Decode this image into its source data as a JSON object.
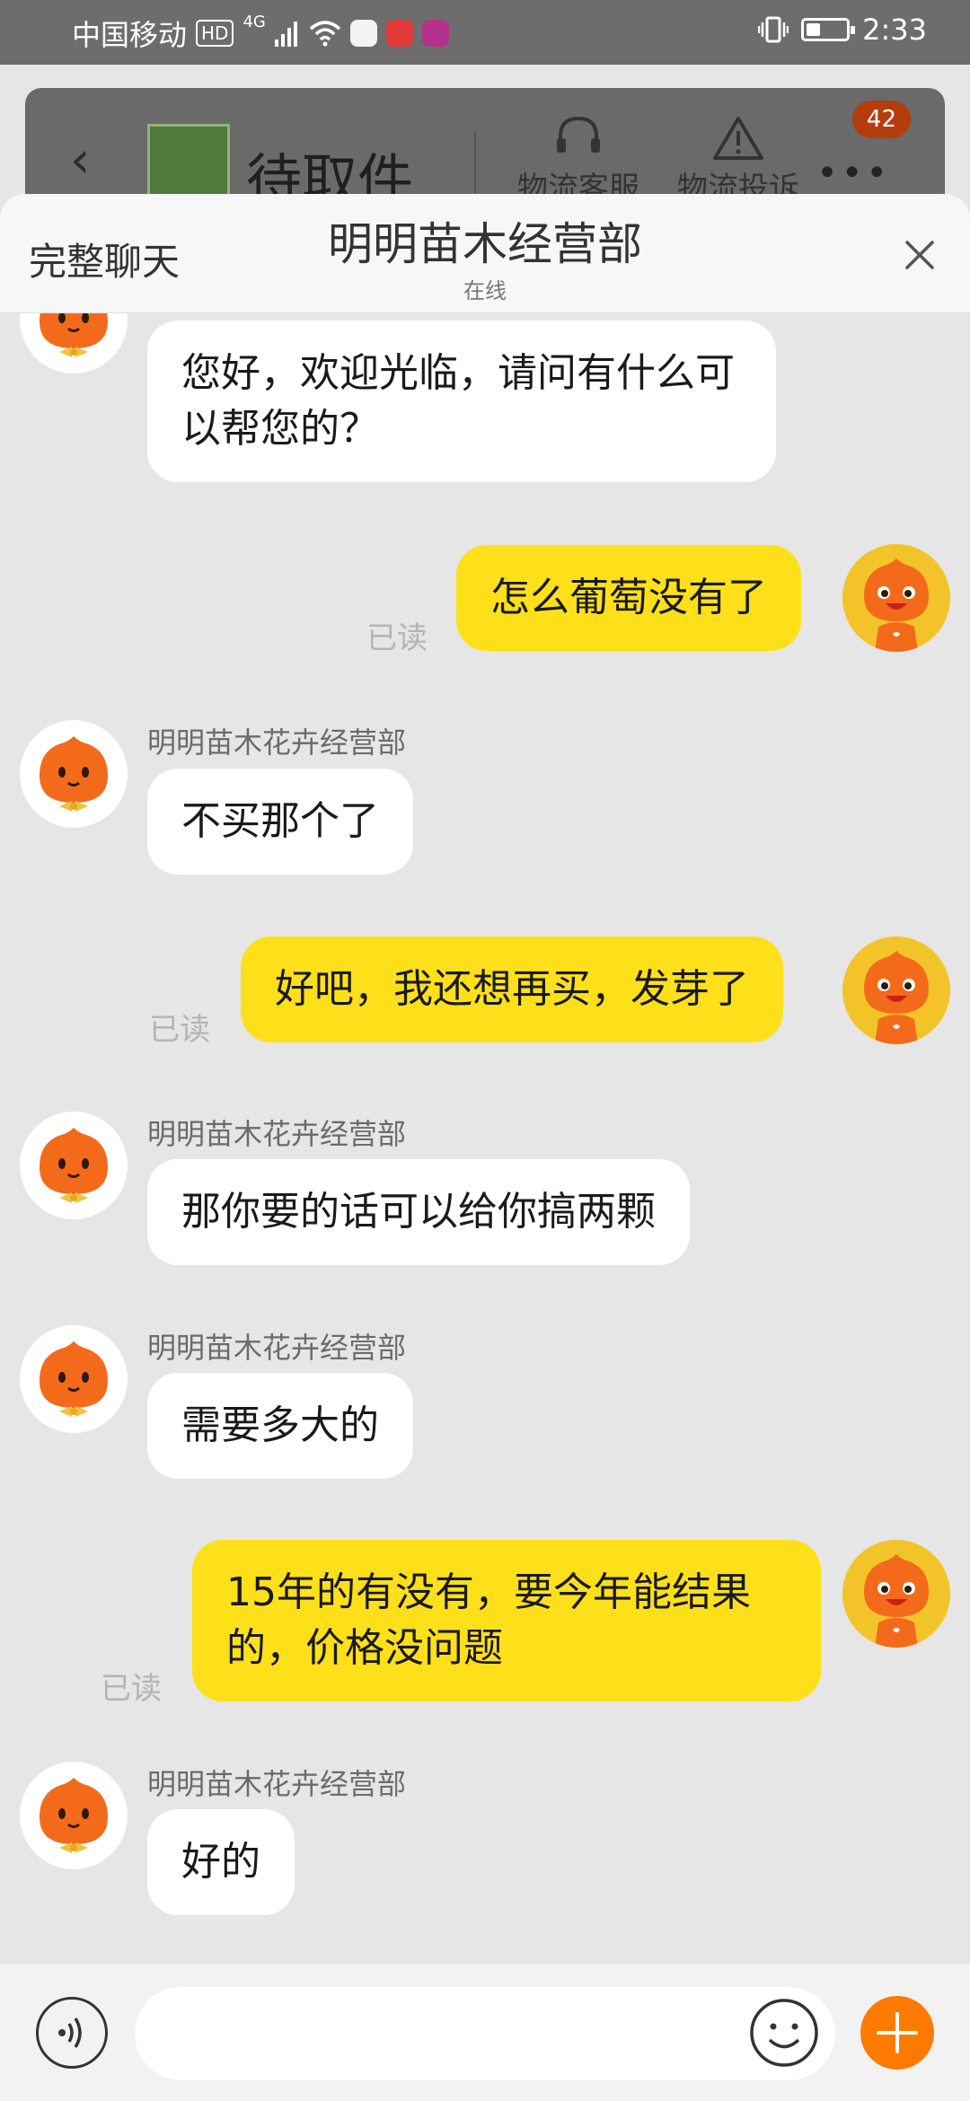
{
  "status_bar": {
    "carrier": "中国移动",
    "hd": "HD",
    "network": "4G",
    "time": "2:33",
    "battery_level": 0.35
  },
  "background_header": {
    "title": "待取件",
    "actions": [
      "物流客服",
      "物流投诉"
    ],
    "badge": "42"
  },
  "chat_header": {
    "full_chat_label": "完整聊天",
    "title": "明明苗木经营部",
    "status": "在线"
  },
  "messages": [
    {
      "side": "in",
      "sender": "",
      "text": "您好，欢迎光临，请问有什么可以帮您的？"
    },
    {
      "side": "out",
      "text": "怎么葡萄没有了",
      "read": "已读"
    },
    {
      "side": "in",
      "sender": "明明苗木花卉经营部",
      "text": "不买那个了"
    },
    {
      "side": "out",
      "text": "好吧，我还想再买，发芽了",
      "read": "已读"
    },
    {
      "side": "in",
      "sender": "明明苗木花卉经营部",
      "text": "那你要的话可以给你搞两颗"
    },
    {
      "side": "in",
      "sender": "明明苗木花卉经营部",
      "text": "需要多大的"
    },
    {
      "side": "out",
      "text": "15年的有没有，要今年能结果的，价格没问题",
      "read": "已读"
    },
    {
      "side": "in",
      "sender": "明明苗木花卉经营部",
      "text": "好的"
    }
  ],
  "input": {
    "placeholder": ""
  },
  "icons": {
    "back": "chevron-left-icon",
    "headset": "headset-icon",
    "warning": "warning-icon",
    "more": "more-dots-icon",
    "close": "close-icon",
    "voice": "voice-icon",
    "emoji": "emoji-icon",
    "plus": "plus-icon"
  },
  "colors": {
    "outgoing_bubble": "#fee01a",
    "incoming_bubble": "#ffffff",
    "chat_background": "#e6e6e6",
    "accent_plus": "#ff7a00",
    "badge": "#b53c0c"
  }
}
